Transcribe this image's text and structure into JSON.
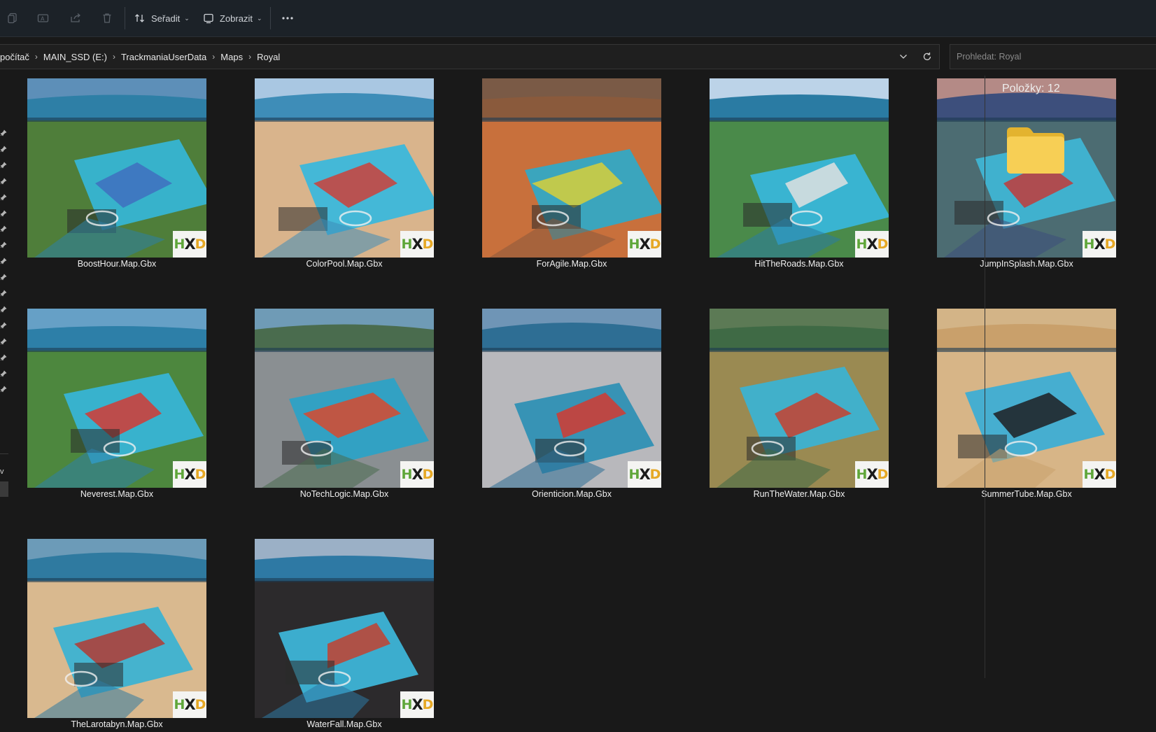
{
  "toolbar": {
    "sort_label": "Seřadit",
    "view_label": "Zobrazit",
    "icons": [
      "copy-icon",
      "rename-icon",
      "share-icon",
      "delete-icon",
      "sort-icon",
      "view-icon",
      "more-icon"
    ]
  },
  "address": {
    "crumbs": [
      "počítač",
      "MAIN_SSD (E:)",
      "TrackmaniaUserData",
      "Maps",
      "Royal"
    ]
  },
  "search": {
    "placeholder": "Prohledat: Royal"
  },
  "nav": {
    "fragment_label": "v"
  },
  "details": {
    "item_count": "Položky: 12"
  },
  "files": [
    {
      "name": "BoostHour.Map.Gbx",
      "palette": {
        "sky": "#5d8fb8",
        "top": "#2e7fa6",
        "ground": "#4f7e3a",
        "accent": "#3f6fbf",
        "water": "#35b6d8"
      }
    },
    {
      "name": "ColorPool.Map.Gbx",
      "palette": {
        "sky": "#a9c7e2",
        "top": "#3e8db8",
        "ground": "#d9b48c",
        "accent": "#cc3f3a",
        "water": "#37b9dd"
      }
    },
    {
      "name": "ForAgile.Map.Gbx",
      "palette": {
        "sky": "#7a5a46",
        "top": "#8a5a3c",
        "ground": "#c8703c",
        "accent": "#d8cf3a",
        "water": "#2fa9c9"
      }
    },
    {
      "name": "HitTheRoads.Map.Gbx",
      "palette": {
        "sky": "#bcd3e8",
        "top": "#2a7ba3",
        "ground": "#4a8a4a",
        "accent": "#e0e0e0",
        "water": "#37b7dc"
      }
    },
    {
      "name": "JumpInSplash.Map.Gbx",
      "palette": {
        "sky": "#b48a86",
        "top": "#3d4f7c",
        "ground": "#4c6c72",
        "accent": "#c23b3a",
        "water": "#3fb7d6"
      }
    },
    {
      "name": "Neverest.Map.Gbx",
      "palette": {
        "sky": "#66a0c6",
        "top": "#2d7fa8",
        "ground": "#4d873e",
        "accent": "#d33a34",
        "water": "#36b5d9"
      }
    },
    {
      "name": "NoTechLogic.Map.Gbx",
      "palette": {
        "sky": "#6f9bb6",
        "top": "#4a6c4e",
        "ground": "#8a8f92",
        "accent": "#d8492e",
        "water": "#2aa3c8"
      }
    },
    {
      "name": "Orienticion.Map.Gbx",
      "palette": {
        "sky": "#6f95b6",
        "top": "#2e6e94",
        "ground": "#b8b8bc",
        "accent": "#d33a30",
        "water": "#2b8fb4"
      }
    },
    {
      "name": "RunTheWater.Map.Gbx",
      "palette": {
        "sky": "#5c7a55",
        "top": "#3f6a45",
        "ground": "#9a8a52",
        "accent": "#c8412f",
        "water": "#39b3d5"
      }
    },
    {
      "name": "SummerTube.Map.Gbx",
      "palette": {
        "sky": "#d3b487",
        "top": "#c9a06b",
        "ground": "#d7b587",
        "accent": "#1f1f22",
        "water": "#3aaed6"
      }
    },
    {
      "name": "TheLarotabyn.Map.Gbx",
      "palette": {
        "sky": "#6c9bb8",
        "top": "#2f7aa0",
        "ground": "#d9b98f",
        "accent": "#b33a33",
        "water": "#38b2d4"
      }
    },
    {
      "name": "WaterFall.Map.Gbx",
      "palette": {
        "sky": "#9bb0c6",
        "top": "#2e79a4",
        "ground": "#2c2a2c",
        "accent": "#c2412f",
        "water": "#3eb9dc"
      }
    }
  ]
}
